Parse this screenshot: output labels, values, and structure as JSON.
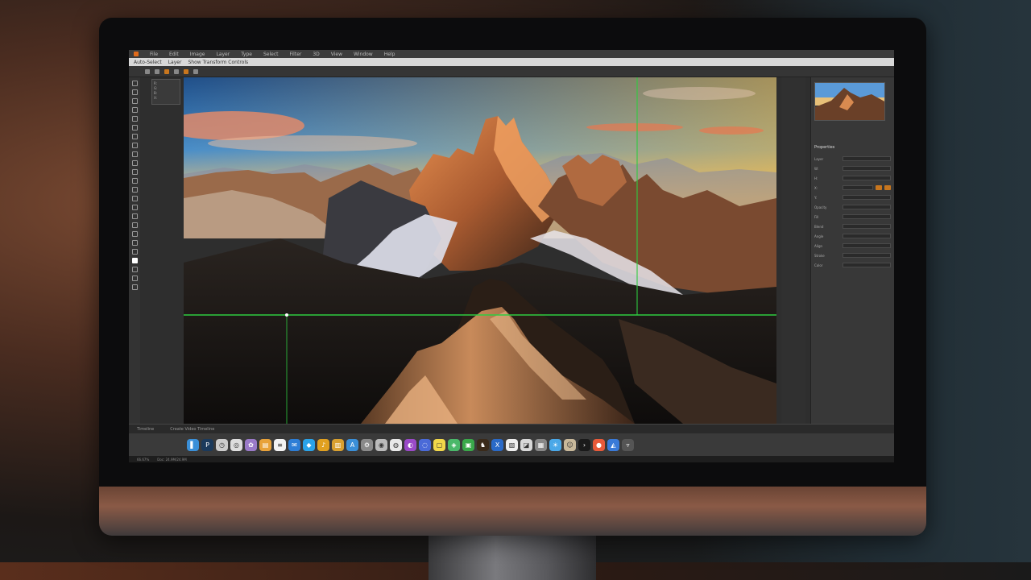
{
  "app": {
    "menu": [
      "File",
      "Edit",
      "Image",
      "Layer",
      "Type",
      "Select",
      "Filter",
      "3D",
      "View",
      "Window",
      "Help"
    ],
    "options": [
      "Auto-Select",
      "Layer",
      "Show Transform Controls"
    ],
    "accent": "#e06a1a",
    "guide_color": "#2ecc40"
  },
  "info_panel": {
    "lines": [
      "R:",
      "G:",
      "B:",
      "X:"
    ]
  },
  "right_panel": {
    "title": "Properties",
    "rows": [
      "Layer",
      "W:",
      "H:",
      "X:",
      "Y:",
      "Opacity",
      "Fill",
      "Blend",
      "Angle",
      "Align",
      "Stroke",
      "Color"
    ]
  },
  "timeline": {
    "labels": [
      "Timeline",
      "Create Video Timeline"
    ]
  },
  "status": {
    "zoom": "66.67%",
    "doc": "Doc: 24.9M/24.9M"
  },
  "dock_icons": [
    {
      "name": "finder-icon",
      "color": "#3a8fd8",
      "glyph": "▌"
    },
    {
      "name": "photoshop-icon",
      "color": "#1b3a5c",
      "glyph": "P"
    },
    {
      "name": "clock-icon",
      "color": "#cccccc",
      "glyph": "◷"
    },
    {
      "name": "safari-icon",
      "color": "#dddddd",
      "glyph": "◎"
    },
    {
      "name": "photos-icon",
      "color": "#9a7ac8",
      "glyph": "✿"
    },
    {
      "name": "folder-icon",
      "color": "#e8a23a",
      "glyph": "▤"
    },
    {
      "name": "notes-icon",
      "color": "#f2f2f2",
      "glyph": "≡"
    },
    {
      "name": "mail-icon",
      "color": "#2d7ed6",
      "glyph": "✉"
    },
    {
      "name": "messages-icon",
      "color": "#2aa3e8",
      "glyph": "◆"
    },
    {
      "name": "music-icon",
      "color": "#e0a020",
      "glyph": "♪"
    },
    {
      "name": "books-icon",
      "color": "#d8a030",
      "glyph": "▥"
    },
    {
      "name": "store-icon",
      "color": "#3a8fd8",
      "glyph": "A"
    },
    {
      "name": "settings-icon",
      "color": "#8a8a8a",
      "glyph": "⚙"
    },
    {
      "name": "camera-icon",
      "color": "#bbbbbb",
      "glyph": "◉"
    },
    {
      "name": "chrome-icon",
      "color": "#e8e8e8",
      "glyph": "◍"
    },
    {
      "name": "podcast-icon",
      "color": "#9a4ac8",
      "glyph": "◐"
    },
    {
      "name": "browser-icon",
      "color": "#4a6ad8",
      "glyph": "◌"
    },
    {
      "name": "stickies-icon",
      "color": "#f2d84a",
      "glyph": "▢"
    },
    {
      "name": "maps-icon",
      "color": "#4ab86a",
      "glyph": "◈"
    },
    {
      "name": "facetime-icon",
      "color": "#3aa84a",
      "glyph": "▣"
    },
    {
      "name": "chess-icon",
      "color": "#3a2a1a",
      "glyph": "♞"
    },
    {
      "name": "xcode-icon",
      "color": "#2a6ac8",
      "glyph": "X"
    },
    {
      "name": "textedit-icon",
      "color": "#eeeeee",
      "glyph": "▧"
    },
    {
      "name": "preview-icon",
      "color": "#d8d8d8",
      "glyph": "◪"
    },
    {
      "name": "calculator-icon",
      "color": "#888888",
      "glyph": "▦"
    },
    {
      "name": "weather-icon",
      "color": "#4aa8e8",
      "glyph": "☀"
    },
    {
      "name": "contacts-icon",
      "color": "#c8b89a",
      "glyph": "☺"
    },
    {
      "name": "terminal-icon",
      "color": "#1a1a1a",
      "glyph": "›"
    },
    {
      "name": "reminders-icon",
      "color": "#e85a3a",
      "glyph": "●"
    },
    {
      "name": "keynote-icon",
      "color": "#3a7ad8",
      "glyph": "◭"
    },
    {
      "name": "trash-icon",
      "color": "#555555",
      "glyph": "▿"
    }
  ]
}
